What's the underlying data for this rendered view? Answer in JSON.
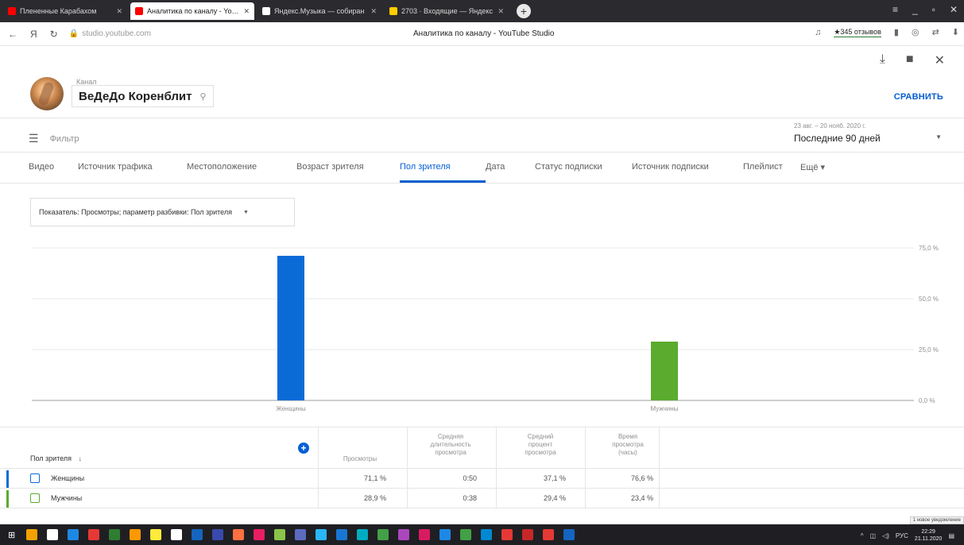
{
  "browser": {
    "tabs": [
      {
        "label": "Плененные Карабахом",
        "color": "#ff0000",
        "active": false
      },
      {
        "label": "Аналитика по каналу - YouT",
        "color": "#ff0000",
        "active": true
      },
      {
        "label": "Яндекс.Музыка — собиран",
        "color": "#ffffff",
        "active": false
      },
      {
        "label": "2703 · Входящие — Яндекс",
        "color": "#ffcc00",
        "active": false
      }
    ],
    "url": "studio.youtube.com",
    "page_title": "Аналитика по каналу - YouTube Studio",
    "reviews": "★345 отзывов"
  },
  "header": {
    "channel_label": "Канал",
    "channel_name": "ВеДеДо Коренблит",
    "compare": "СРАВНИТЬ"
  },
  "filter": {
    "label": "Фильтр",
    "date_sub": "23 авг. – 20 нояб. 2020 г.",
    "date_main": "Последние 90 дней"
  },
  "tabs": [
    {
      "label": "Видео",
      "w": 62
    },
    {
      "label": "Источник трафика",
      "w": 137
    },
    {
      "label": "Местоположение",
      "w": 138
    },
    {
      "label": "Возраст зрителя",
      "w": 130
    },
    {
      "label": "Пол зрителя",
      "w": 108,
      "active": true
    },
    {
      "label": "Дата",
      "w": 62
    },
    {
      "label": "Статус подписки",
      "w": 122
    },
    {
      "label": "Источник подписки",
      "w": 140
    },
    {
      "label": "Плейлист",
      "w": 72
    },
    {
      "label": "Ещё ▾",
      "w": 60
    }
  ],
  "metric_select": "Показатель: Просмотры; параметр разбивки: Пол зрителя",
  "chart_data": {
    "type": "bar",
    "categories": [
      "Женщины",
      "Мужчины"
    ],
    "values": [
      71.1,
      28.9
    ],
    "colors": [
      "#0b6bd6",
      "#5aab2e"
    ],
    "ylim": [
      0,
      75
    ],
    "yticks": [
      "0,0 %",
      "25,0 %",
      "50,0 %",
      "75,0 %"
    ],
    "ytick_values": [
      0,
      25,
      50,
      75
    ]
  },
  "table": {
    "dimension_header": "Пол зрителя",
    "columns": [
      [
        "Просмотры"
      ],
      [
        "Средняя",
        "длительность",
        "просмотра"
      ],
      [
        "Средний",
        "процент",
        "просмотра"
      ],
      [
        "Время",
        "просмотра",
        "(часы)"
      ]
    ],
    "rows": [
      {
        "label": "Женщины",
        "color": "#0b6bd6",
        "cells": [
          "71,1 %",
          "0:50",
          "37,1 %",
          "76,6 %"
        ]
      },
      {
        "label": "Мужчины",
        "color": "#5aab2e",
        "cells": [
          "28,9 %",
          "0:38",
          "29,4 %",
          "23,4 %"
        ]
      }
    ]
  },
  "tray": {
    "lang": "РУС",
    "time": "22:29",
    "date": "21.11.2020",
    "notification": "1 новое уведомление"
  }
}
